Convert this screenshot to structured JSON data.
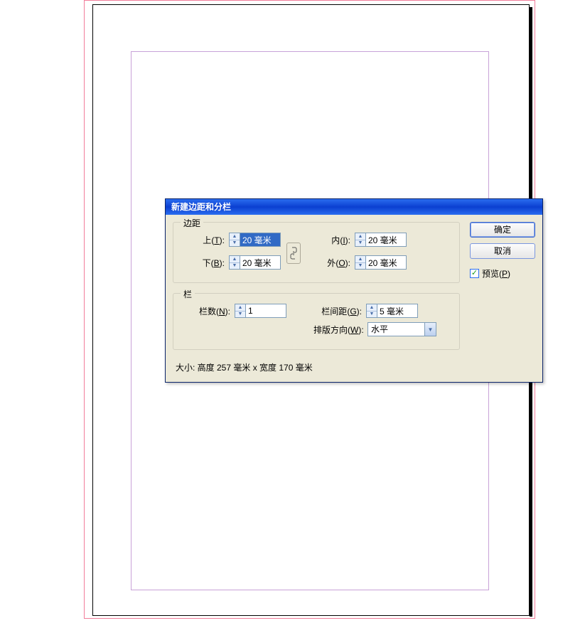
{
  "dialog": {
    "title": "新建边距和分栏",
    "margins": {
      "legend": "边距",
      "top": {
        "label": "上",
        "mn": "T",
        "value": "20 毫米"
      },
      "bottom": {
        "label": "下",
        "mn": "B",
        "value": "20 毫米"
      },
      "inside": {
        "label": "内",
        "mn": "I",
        "value": "20 毫米"
      },
      "outside": {
        "label": "外",
        "mn": "O",
        "value": "20 毫米"
      }
    },
    "columns": {
      "legend": "栏",
      "count": {
        "label": "栏数",
        "mn": "N",
        "value": "1"
      },
      "gutter": {
        "label": "栏间距",
        "mn": "G",
        "value": "5 毫米"
      },
      "direction": {
        "label": "排版方向",
        "mn": "W",
        "value": "水平"
      }
    },
    "size_readout": "大小: 高度 257 毫米 x 宽度 170 毫米",
    "buttons": {
      "ok": "确定",
      "cancel": "取消",
      "preview_label": "预览",
      "preview_mn": "P",
      "preview_checked": true
    }
  }
}
